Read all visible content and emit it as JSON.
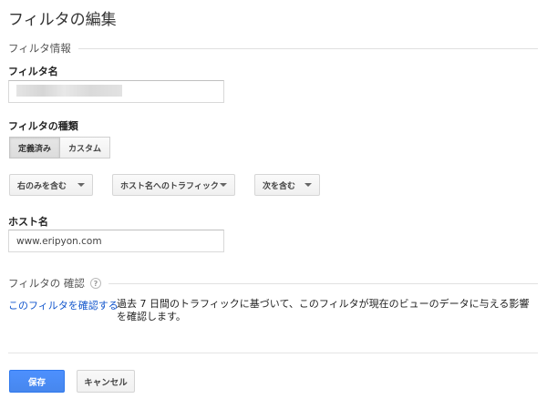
{
  "page": {
    "title": "フィルタの編集"
  },
  "sections": {
    "info": "フィルタ情報",
    "verify": "フィルタの 確認",
    "verify_help": "?"
  },
  "filter_name": {
    "label": "フィルタ名",
    "value": ""
  },
  "filter_type": {
    "label": "フィルタの種類",
    "tabs": [
      {
        "label": "定義済み",
        "active": true
      },
      {
        "label": "カスタム",
        "active": false
      }
    ],
    "dropdowns": [
      {
        "label": "右のみを含む"
      },
      {
        "label": "ホスト名へのトラフィック"
      },
      {
        "label": "次を含む"
      }
    ]
  },
  "hostname": {
    "label": "ホスト名",
    "value": "www.eripyon.com"
  },
  "verify": {
    "link": "このフィルタを確認する",
    "description": "過去 7 日間のトラフィックに基づいて、このフィルタが現在のビューのデータに与える影響を確認します。"
  },
  "actions": {
    "save": "保存",
    "cancel": "キャンセル"
  }
}
